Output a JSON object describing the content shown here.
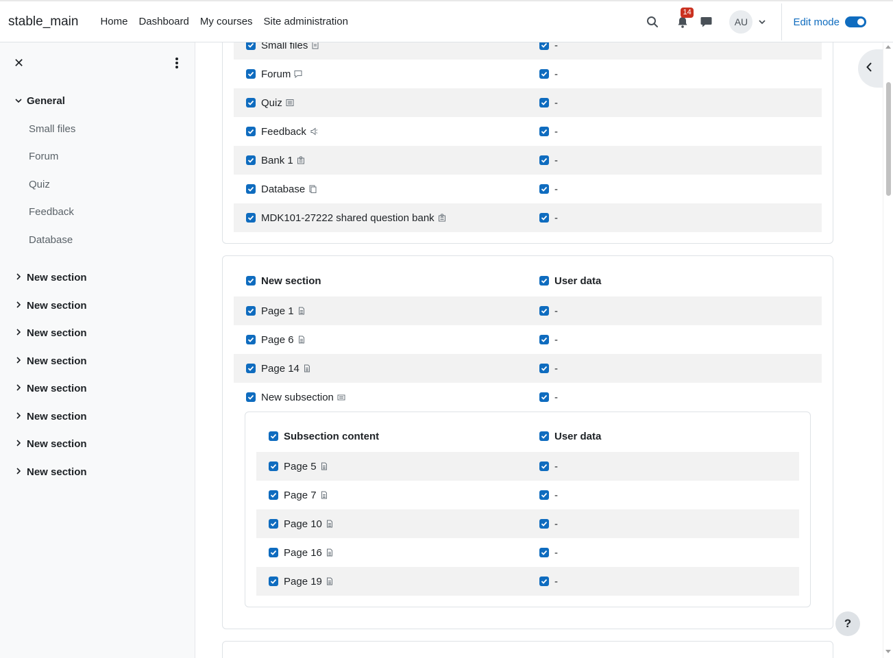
{
  "navbar": {
    "brand": "stable_main",
    "links": [
      "Home",
      "Dashboard",
      "My courses",
      "Site administration"
    ],
    "notification_count": "14",
    "avatar_initials": "AU",
    "edit_mode_label": "Edit mode",
    "edit_mode_on": true
  },
  "drawer": {
    "general": "General",
    "general_items": [
      "Small files",
      "Forum",
      "Quiz",
      "Feedback",
      "Database"
    ],
    "sections": [
      "New section",
      "New section",
      "New section",
      "New section",
      "New section",
      "New section",
      "New section",
      "New section"
    ]
  },
  "general_card": {
    "rows": [
      {
        "label": "Small files",
        "icon": "file-icon",
        "value": "-"
      },
      {
        "label": "Forum",
        "icon": "forum-icon",
        "value": "-"
      },
      {
        "label": "Quiz",
        "icon": "quiz-icon",
        "value": "-"
      },
      {
        "label": "Feedback",
        "icon": "feedback-icon",
        "value": "-"
      },
      {
        "label": "Bank 1",
        "icon": "question-bank-icon",
        "value": "-"
      },
      {
        "label": "Database",
        "icon": "database-icon",
        "value": "-"
      },
      {
        "label": "MDK101-27222 shared question bank",
        "icon": "question-bank-icon",
        "value": "-"
      }
    ]
  },
  "section_card": {
    "header": "New section",
    "header_right": "User data",
    "rows": [
      {
        "label": "Page 1",
        "icon": "page-icon",
        "value": "-"
      },
      {
        "label": "Page 6",
        "icon": "page-icon",
        "value": "-"
      },
      {
        "label": "Page 14",
        "icon": "page-icon",
        "value": "-"
      },
      {
        "label": "New subsection",
        "icon": "subsection-icon",
        "value": "-"
      }
    ],
    "subsection": {
      "header": "Subsection content",
      "header_right": "User data",
      "rows": [
        {
          "label": "Page 5",
          "icon": "page-icon",
          "value": "-"
        },
        {
          "label": "Page 7",
          "icon": "page-icon",
          "value": "-"
        },
        {
          "label": "Page 10",
          "icon": "page-icon",
          "value": "-"
        },
        {
          "label": "Page 16",
          "icon": "page-icon",
          "value": "-"
        },
        {
          "label": "Page 19",
          "icon": "page-icon",
          "value": "-"
        }
      ]
    }
  },
  "help_label": "?",
  "colors": {
    "primary": "#0f6cbf",
    "badge": "#ca3120",
    "shade": "#f2f2f2",
    "drawer_bg": "#f8f9fa"
  }
}
